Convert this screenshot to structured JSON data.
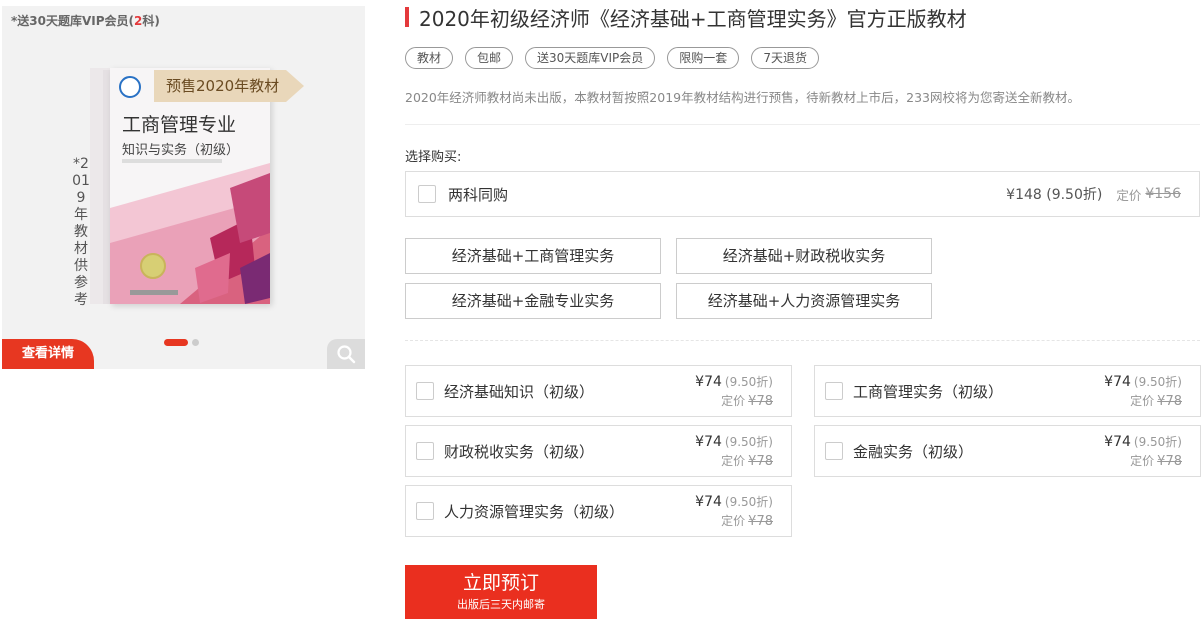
{
  "gallery": {
    "promo_prefix": "*送30天题库VIP会员(",
    "promo_count": "2",
    "promo_suffix": "科)",
    "presale_badge": "预售2020年教材",
    "book_title": "工商管理专业",
    "book_subtitle": "知识与实务（初级）",
    "vertical_note": "*2019年教材供参考",
    "detail_button": "查看详情",
    "active_slide": 1,
    "total_slides": 2,
    "icons": {
      "zoom": "search-icon"
    }
  },
  "product": {
    "title": "2020年初级经济师《经济基础+工商管理实务》官方正版教材",
    "tags": [
      "教材",
      "包邮",
      "送30天题库VIP会员",
      "限购一套",
      "7天退货"
    ],
    "notice": "2020年经济师教材尚未出版，本教材暂按照2019年教材结构进行预售，待新教材上市后，233网校将为您寄送全新教材。",
    "choose_label": "选择购买:",
    "bundle": {
      "name": "两科同购",
      "price": "¥148 (9.50折)",
      "orig_label": "定价",
      "orig_price": "¥156"
    },
    "combo_options": [
      "经济基础+工商管理实务",
      "经济基础+财政税收实务",
      "经济基础+金融专业实务",
      "经济基础+人力资源管理实务"
    ],
    "subjects": [
      {
        "name": "经济基础知识（初级）",
        "price": "¥74",
        "discount": "(9.50折)",
        "orig_label": "定价",
        "orig": "¥78"
      },
      {
        "name": "工商管理实务（初级）",
        "price": "¥74",
        "discount": "(9.50折)",
        "orig_label": "定价",
        "orig": "¥78"
      },
      {
        "name": "财政税收实务（初级）",
        "price": "¥74",
        "discount": "(9.50折)",
        "orig_label": "定价",
        "orig": "¥78"
      },
      {
        "name": "金融实务（初级）",
        "price": "¥74",
        "discount": "(9.50折)",
        "orig_label": "定价",
        "orig": "¥78"
      },
      {
        "name": "人力资源管理实务（初级）",
        "price": "¥74",
        "discount": "(9.50折)",
        "orig_label": "定价",
        "orig": "¥78"
      }
    ],
    "buy_button": {
      "label": "立即预订",
      "sub": "出版后三天内邮寄"
    }
  },
  "colors": {
    "accent": "#e4393c",
    "button": "#ea2f1f",
    "presale_badge": "#e9d7ba"
  }
}
